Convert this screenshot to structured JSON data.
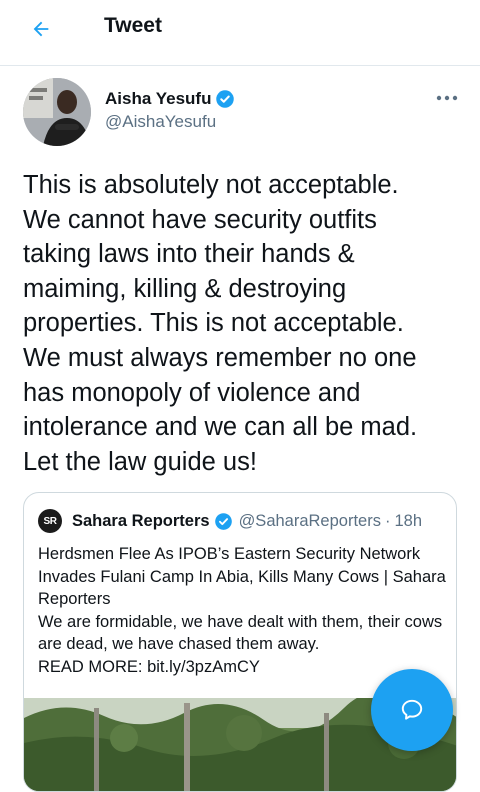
{
  "header": {
    "title": "Tweet",
    "back_icon": "arrow-left-icon"
  },
  "tweet": {
    "author_name": "Aisha Yesufu",
    "author_handle": "@AishaYesufu",
    "verified": true,
    "text": "This is absolutely not acceptable.\nWe cannot have security outfits\ntaking laws into their hands &\nmaiming, killing & destroying\nproperties. This is not acceptable.\nWe must always remember no one\nhas monopoly of violence and\nintolerance and we can all be mad.\nLet the law guide us!"
  },
  "quote": {
    "logo_text": "SR",
    "author_name": "Sahara Reporters",
    "author_handle": "@SaharaReporters",
    "separator": "·",
    "time": "18h",
    "headline": "Herdsmen Flee As IPOB’s Eastern Security Network Invades Fulani Camp In Abia, Kills Many Cows | Sahara Reporters",
    "body": "We are formidable, we have dealt with them, their cows are dead, we have chased them away.",
    "read_more": "READ MORE: bit.ly/3pzAmCY"
  },
  "colors": {
    "accent": "#1da1f2",
    "text_primary": "#0f1419",
    "text_secondary": "#5b7083",
    "border": "#cfd9de"
  },
  "icons": {
    "verified": "verified-badge-icon",
    "more": "more-horizontal-icon",
    "fab": "compose-reply-icon"
  }
}
